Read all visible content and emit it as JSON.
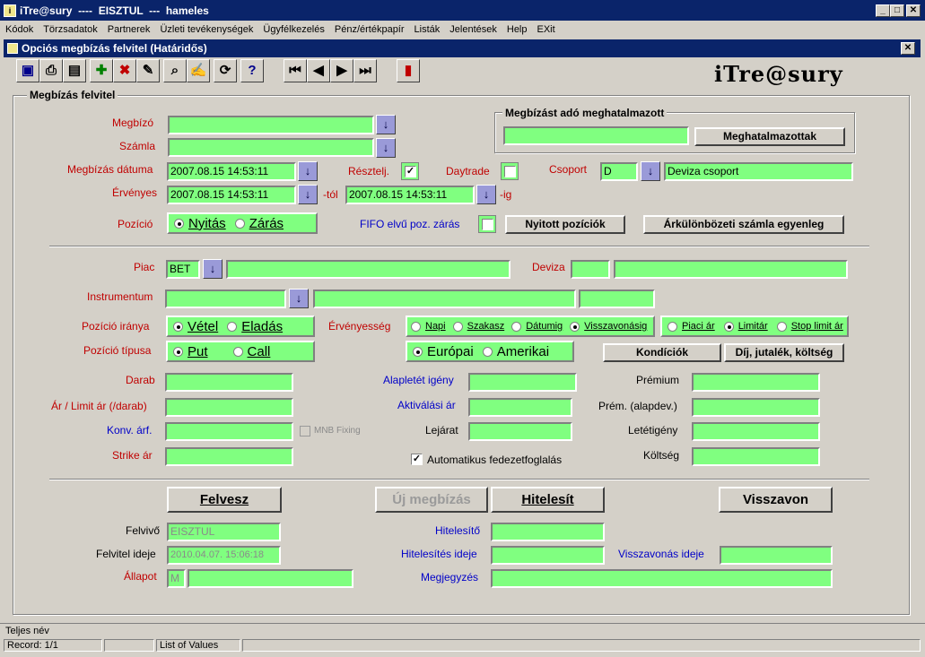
{
  "window": {
    "title": "iTre@sury  ----  EISZTUL  ---  hameles",
    "min": "_",
    "max": "□",
    "close": "✕"
  },
  "menu": [
    "Kódok",
    "Törzsadatok",
    "Partnerek",
    "Üzleti tevékenységek",
    "Ügyfélkezelés",
    "Pénz/értékpapír",
    "Listák",
    "Jelentések",
    "Help",
    "EXit"
  ],
  "form": {
    "title": "Opciós megbízás felvitel (Határidős)",
    "close": "✕"
  },
  "brand": "iTre@sury",
  "group": {
    "title": "Megbízás felvitel"
  },
  "top": {
    "megbizo_label": "Megbízó",
    "szamla_label": "Számla",
    "datum_label": "Megbízás dátuma",
    "ervenyes_label": "Érvényes",
    "datum_value": "2007.08.15 14:53:11",
    "ervenyes_from": "2007.08.15 14:53:11",
    "tol": "-tól",
    "ervenyes_to": "2007.08.15 14:53:11",
    "ig": "-ig",
    "resztelj_label": "Résztelj.",
    "daytrade_label": "Daytrade",
    "csoport_label": "Csoport",
    "csoport_code": "D",
    "csoport_name": "Deviza csoport",
    "pozicio_label": "Pozíció",
    "nyitas": "Nyitás",
    "zaras": "Zárás",
    "fifo_label": "FIFO elvű poz. zárás",
    "nyitott_btn": "Nyitott pozíciók",
    "arkulonbozet_btn": "Árkülönbözeti számla egyenleg",
    "meghatalmazott_title": "Megbízást adó meghatalmazott",
    "meghatalmazottak_btn": "Meghatalmazottak"
  },
  "mid": {
    "piac_label": "Piac",
    "piac_value": "BET",
    "deviza_label": "Deviza",
    "instrumentum_label": "Instrumentum",
    "irany_label": "Pozíció iránya",
    "vetel": "Vétel",
    "eladas": "Eladás",
    "tipus_label": "Pozíció típusa",
    "put": "Put",
    "call": "Call",
    "ervenyesseg_label": "Érvényesség",
    "napi": "Napi",
    "szakasz": "Szakasz",
    "datumig": "Dátumig",
    "visszavonasig": "Visszavonásig",
    "piaci_ar": "Piaci ár",
    "limitar": "Limitár",
    "stop_limit": "Stop limit ár",
    "europai": "Európai",
    "amerikai": "Amerikai",
    "kondiciok_btn": "Kondíciók",
    "dij_btn": "Díj, jutalék, költség",
    "darab_label": "Darab",
    "ar_label": "Ár / Limit ár (/darab)",
    "konv_label": "Konv. árf.",
    "mnb_label": "MNB Fixing",
    "strike_label": "Strike ár",
    "alapletet_label": "Alapletét igény",
    "aktivalasi_label": "Aktiválási ár",
    "lejarat_label": "Lejárat",
    "premium_label": "Prémium",
    "prem_alap_label": "Prém. (alapdev.)",
    "letetigeny_label": "Letétigény",
    "koltseg_label": "Költség",
    "auto_label": "Automatikus fedezetfoglalás"
  },
  "bottom": {
    "felvesz": "Felvesz",
    "uj": "Új megbízás",
    "hitelesit": "Hitelesít",
    "visszavon": "Visszavon",
    "felvivo_label": "Felvivő",
    "felvivo_value": "EISZTUL",
    "felvitel_ideje_label": "Felvitel ideje",
    "felvitel_ideje_value": "2010.04.07. 15:06:18",
    "allapot_label": "Állapot",
    "allapot_value": "M",
    "hitelesito_label": "Hitelesítő",
    "hitelesites_ideje_label": "Hitelesítés ideje",
    "visszavonas_ideje_label": "Visszavonás ideje",
    "megjegyzes_label": "Megjegyzés"
  },
  "status": {
    "hint": "Teljes név",
    "record": "Record: 1/1",
    "lov": "List of Values"
  },
  "colors": {
    "field": "#80ff80",
    "titlebar": "#0a246a",
    "label_red": "#c00000",
    "label_blue": "#0000c8"
  }
}
